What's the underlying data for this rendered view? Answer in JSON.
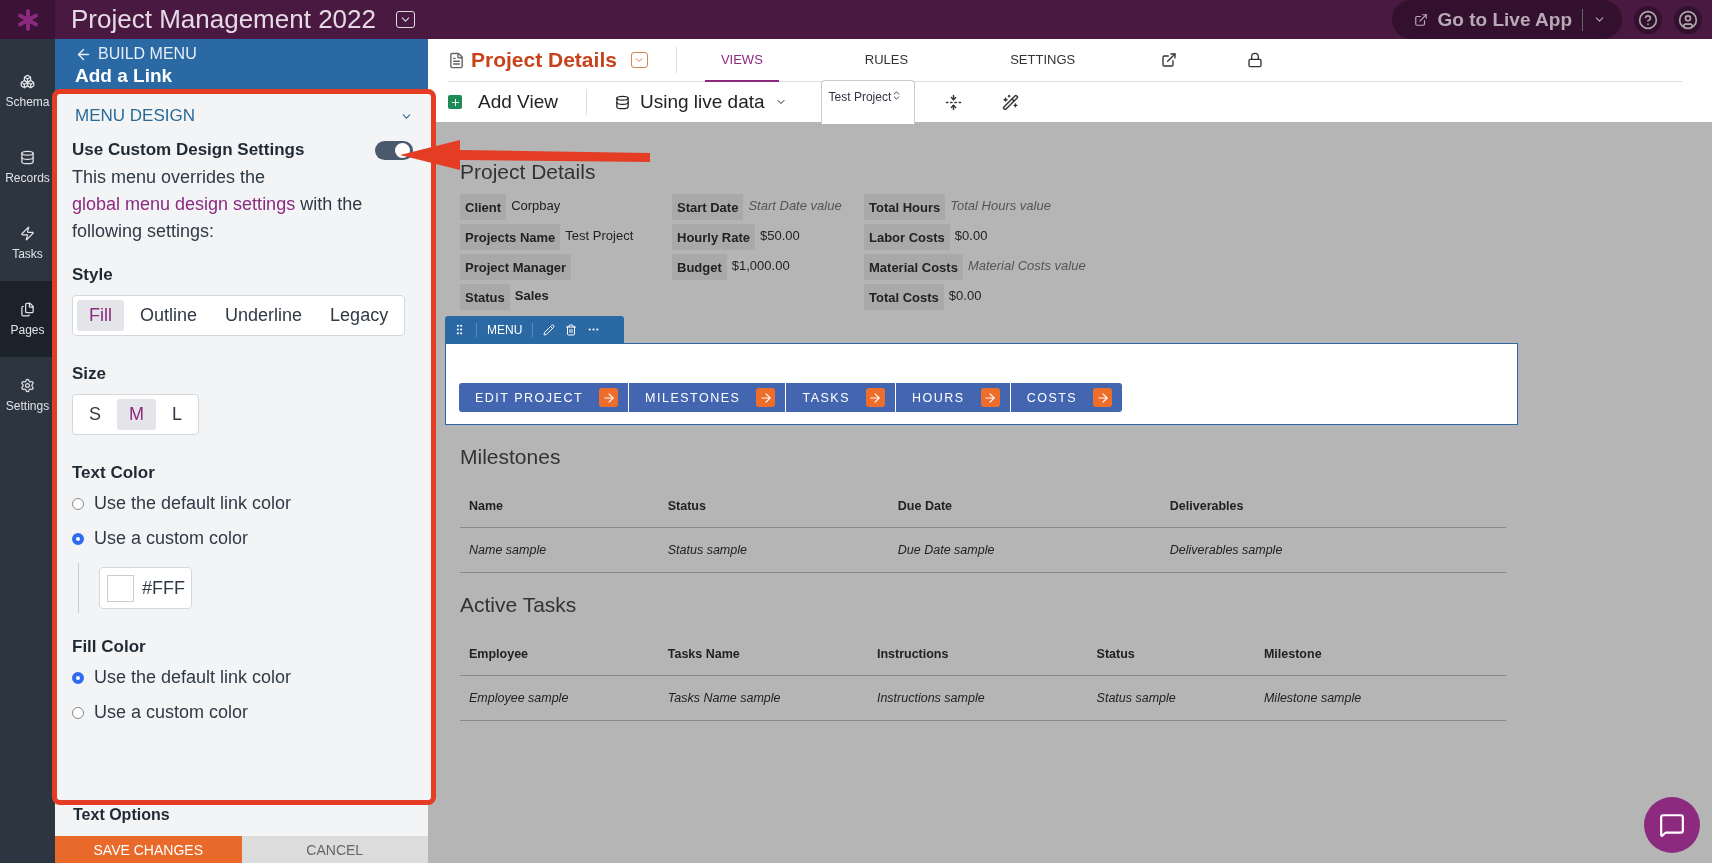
{
  "app_bar": {
    "title": "Project Management 2022",
    "live_button": "Go to Live App"
  },
  "nav_rail": [
    {
      "label": "Schema",
      "selected": false
    },
    {
      "label": "Records",
      "selected": false
    },
    {
      "label": "Tasks",
      "selected": false
    },
    {
      "label": "Pages",
      "selected": true
    },
    {
      "label": "Settings",
      "selected": false
    }
  ],
  "panel": {
    "back_link": "BUILD MENU",
    "title": "Add a Link",
    "section": "MENU DESIGN",
    "custom_toggle": {
      "label": "Use Custom Design Settings",
      "on": true
    },
    "description": "This menu overrides the ",
    "description_link": "global menu design settings",
    "description_end": " with the following settings:",
    "style": {
      "label": "Style",
      "options": [
        {
          "label": "Fill",
          "selected": true
        },
        {
          "label": "Outline",
          "selected": false
        },
        {
          "label": "Underline",
          "selected": false
        },
        {
          "label": "Legacy",
          "selected": false
        }
      ]
    },
    "size": {
      "label": "Size",
      "options": [
        {
          "label": "S",
          "selected": false
        },
        {
          "label": "M",
          "selected": true
        },
        {
          "label": "L",
          "selected": false
        }
      ]
    },
    "text_color": {
      "label": "Text Color",
      "options": [
        {
          "label": "Use the default link color",
          "selected": false
        },
        {
          "label": "Use a custom color",
          "selected": true
        }
      ],
      "value": "#FFF",
      "color": "#ffffff"
    },
    "fill_color": {
      "label": "Fill Color",
      "options": [
        {
          "label": "Use the default link color",
          "selected": true
        },
        {
          "label": "Use a custom color",
          "selected": false
        }
      ]
    },
    "next_section": "Text Options",
    "save": "SAVE CHANGES",
    "cancel": "CANCEL"
  },
  "page_header": {
    "title": "Project Details",
    "tabs": [
      {
        "label": "VIEWS",
        "selected": true
      },
      {
        "label": "RULES",
        "selected": false
      },
      {
        "label": "SETTINGS",
        "selected": false
      }
    ],
    "add_view": "Add View",
    "data_source": "Using live data",
    "record_select": "Test Project"
  },
  "canvas": {
    "title": "Project Details",
    "details": [
      [
        {
          "label": "Client",
          "value": "Corpbay",
          "kind": "text"
        },
        {
          "label": "Projects Name",
          "value": "Test Project",
          "kind": "text"
        },
        {
          "label": "Project Manager",
          "kind": "empty"
        },
        {
          "label": "Status",
          "value": "Sales",
          "kind": "bold"
        }
      ],
      [
        {
          "label": "Start Date",
          "placeholder": "Start Date value",
          "kind": "text"
        },
        {
          "label": "Hourly Rate",
          "value": "$50.00",
          "kind": "text"
        },
        {
          "label": "Budget",
          "value": "$1,000.00",
          "kind": "text"
        }
      ],
      [
        {
          "label": "Total Hours",
          "placeholder": "Total Hours value",
          "kind": "text"
        },
        {
          "label": "Labor Costs",
          "value": "$0.00",
          "kind": "text"
        },
        {
          "label": "Material Costs",
          "placeholder": "Material Costs value",
          "kind": "text"
        },
        {
          "label": "Total Costs",
          "value": "$0.00",
          "kind": "text"
        }
      ]
    ],
    "menu_toolbar": "MENU",
    "menu_links": [
      "EDIT PROJECT",
      "MILESTONES",
      "TASKS",
      "HOURS",
      "COSTS"
    ],
    "tables": [
      {
        "title": "Milestones",
        "columns": [
          "Name",
          "Status",
          "Due Date",
          "Deliverables"
        ],
        "rows": [
          [
            "Name sample",
            "Status sample",
            "Due Date sample",
            "Deliverables sample"
          ]
        ]
      },
      {
        "title": "Active Tasks",
        "columns": [
          "Employee",
          "Tasks Name",
          "Instructions",
          "Status",
          "Milestone"
        ],
        "rows": [
          [
            "Employee sample",
            "Tasks Name sample",
            "Instructions sample",
            "Status sample",
            "Milestone sample"
          ]
        ]
      }
    ]
  }
}
